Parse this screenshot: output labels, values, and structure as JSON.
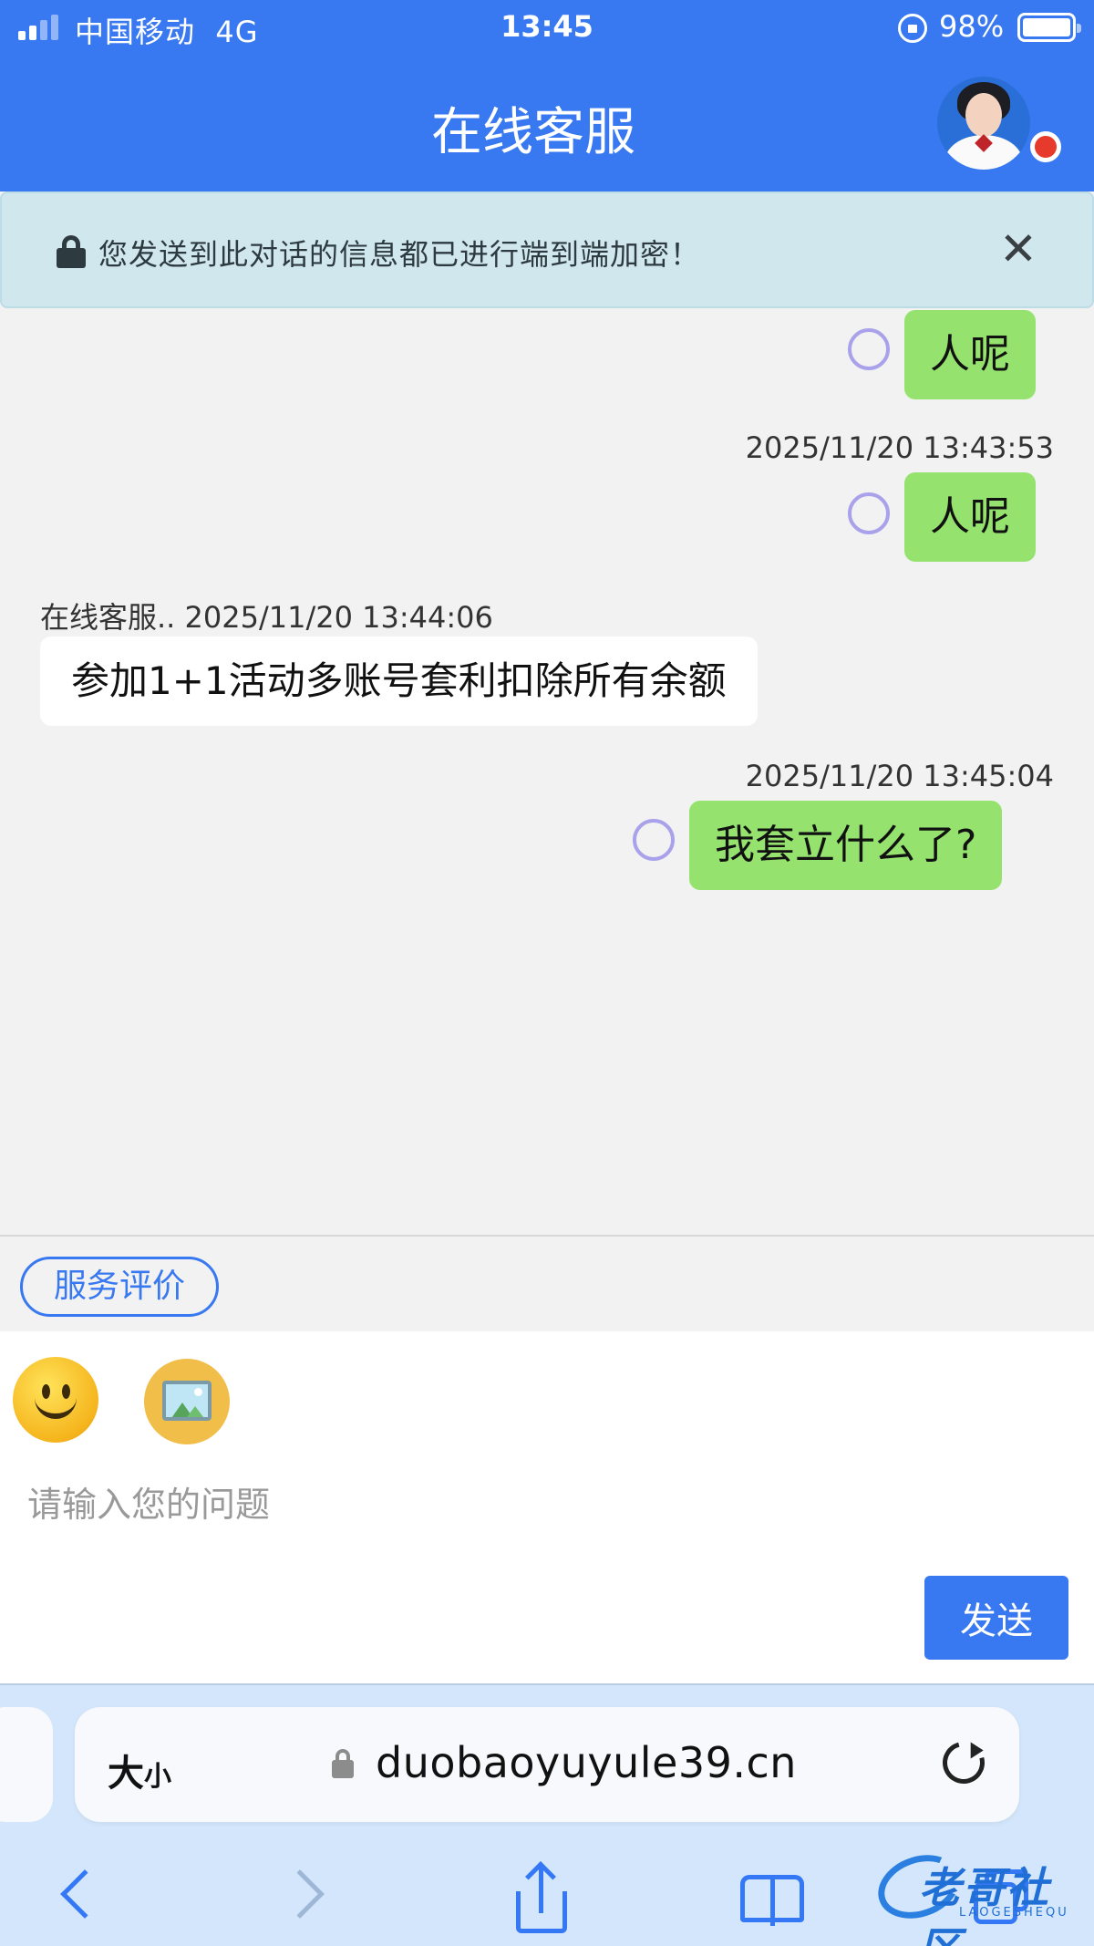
{
  "status_bar": {
    "carrier": "中国移动",
    "network": "4G",
    "time": "13:45",
    "battery_percent": "98%"
  },
  "header": {
    "title": "在线客服",
    "online_status_color": "#e53a2c"
  },
  "banner": {
    "text": "您发送到此对话的信息都已进行端到端加密！",
    "close_label": "✕"
  },
  "messages": [
    {
      "sender": "me",
      "timestamp": "",
      "text": "人呢"
    },
    {
      "sender": "me",
      "timestamp": "2025/11/20 13:43:53",
      "text": "人呢"
    },
    {
      "sender": "agent",
      "name": "在线客服..",
      "timestamp": "2025/11/20 13:44:06",
      "text": "参加1+1活动多账号套利扣除所有余额"
    },
    {
      "sender": "me",
      "timestamp": "2025/11/20 13:45:04",
      "text": "我套立什么了?"
    }
  ],
  "rate_button": "服务评价",
  "composer": {
    "placeholder": "请输入您的问题",
    "emoji_icon": "smiley-icon",
    "image_icon": "image-icon",
    "send_label": "发送"
  },
  "browser": {
    "text_size_label_big": "大",
    "text_size_label_small": "小",
    "url": "duobaoyuyule39.cn"
  },
  "watermark": {
    "text": "老哥社区",
    "sub": "LAOGESHEQU"
  },
  "colors": {
    "header_blue": "#3878f0",
    "my_bubble": "#95e36e",
    "banner_bg": "#d1e7ee",
    "send_button": "#3878f0"
  }
}
